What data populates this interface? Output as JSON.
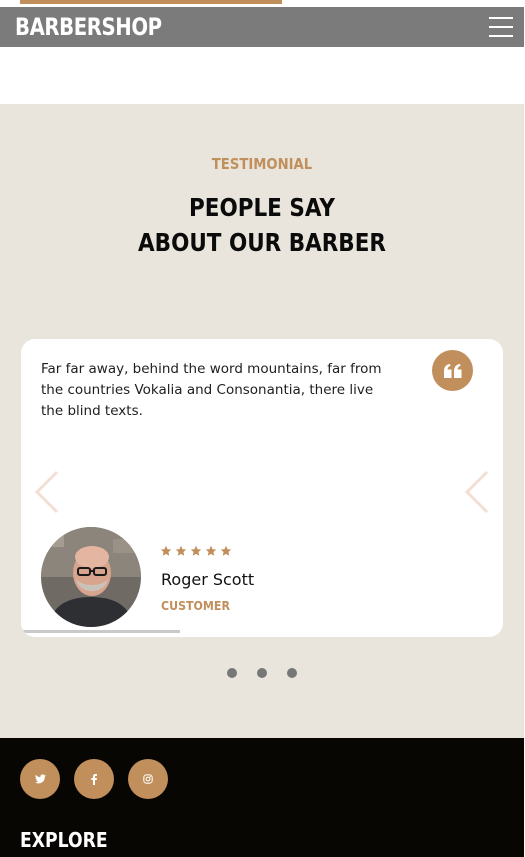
{
  "colors": {
    "accent": "#c08f5c",
    "nav_bg": "#7b7b7b",
    "section_bg": "#e9e5dd",
    "footer_bg": "#080603",
    "heading_text": "#0b0b0b"
  },
  "header": {
    "brand": "BARBERSHOP",
    "menu_icon": "hamburger-icon"
  },
  "testimonial": {
    "subheading": "TESTIMONIAL",
    "heading_line1": "PEOPLE SAY",
    "heading_line2": "ABOUT OUR BARBER",
    "slide": {
      "text": "Far far away, behind the word mountains, far from the countries Vokalia and Consonantia, there live the blind texts.",
      "quote_icon": "quote-icon",
      "rating": 5,
      "name": "Roger Scott",
      "role": "CUSTOMER",
      "progress_fraction": 0.33
    },
    "prev_icon": "chevron-left-icon",
    "next_icon": "chevron-right-icon",
    "dots_count": 3
  },
  "footer": {
    "social": [
      "twitter-icon",
      "facebook-icon",
      "instagram-icon"
    ],
    "explore_heading": "EXPLORE"
  }
}
